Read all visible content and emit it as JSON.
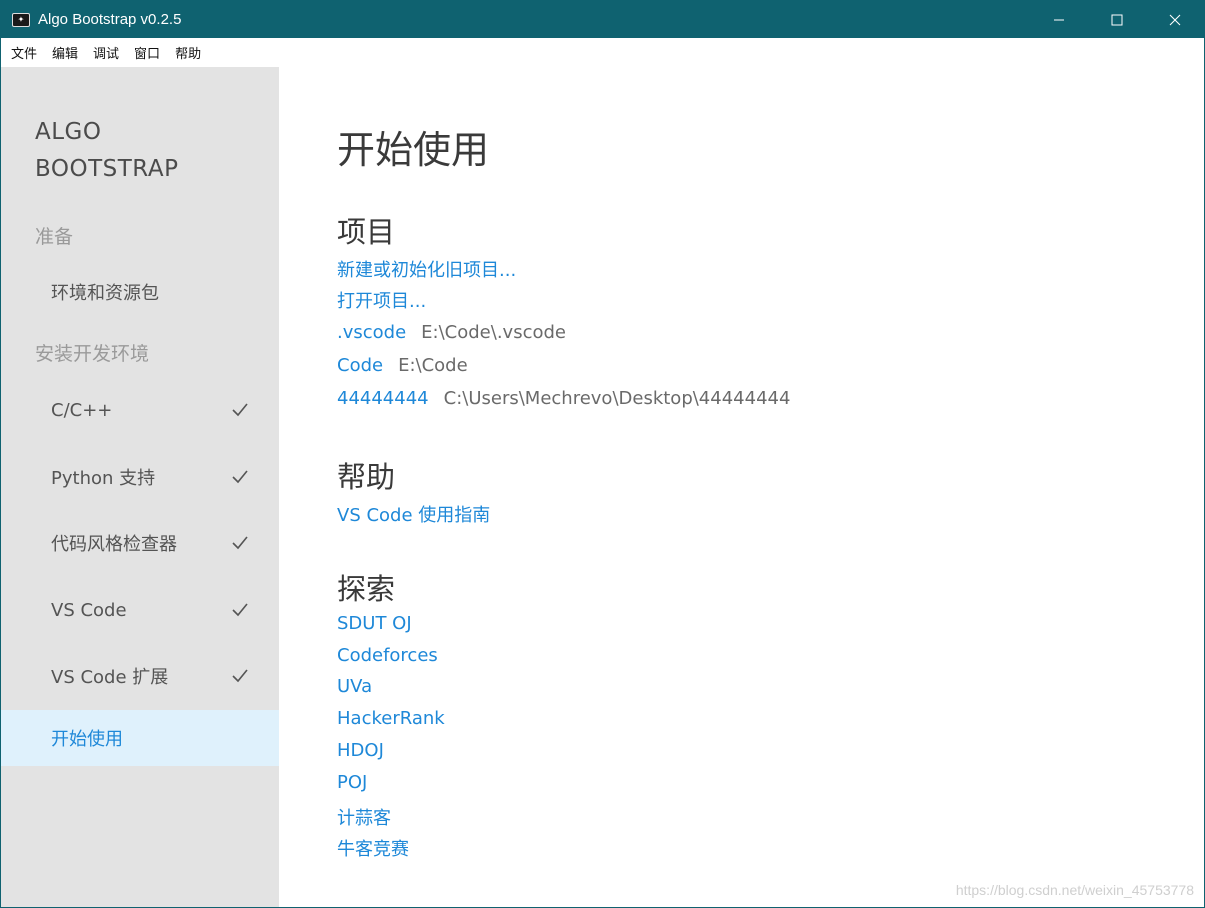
{
  "window": {
    "title": "Algo Bootstrap v0.2.5"
  },
  "menu": [
    "文件",
    "编辑",
    "调试",
    "窗口",
    "帮助"
  ],
  "sidebar": {
    "brand_line1": "ALGO",
    "brand_line2": "BOOTSTRAP",
    "sections": [
      {
        "title": "准备",
        "items": [
          {
            "label": "环境和资源包",
            "checked": false
          }
        ]
      },
      {
        "title": "安装开发环境",
        "items": [
          {
            "label": "C/C++",
            "checked": true
          },
          {
            "label": "Python 支持",
            "checked": true
          },
          {
            "label": "代码风格检查器",
            "checked": true
          },
          {
            "label": "VS Code",
            "checked": true
          },
          {
            "label": "VS Code 扩展",
            "checked": true
          },
          {
            "label": "开始使用",
            "checked": false,
            "active": true
          }
        ]
      }
    ]
  },
  "main": {
    "title": "开始使用",
    "project": {
      "heading": "项目",
      "actions": [
        "新建或初始化旧项目...",
        "打开项目..."
      ],
      "recent": [
        {
          "name": ".vscode",
          "path": "E:\\Code\\.vscode"
        },
        {
          "name": "Code",
          "path": "E:\\Code"
        },
        {
          "name": "44444444",
          "path": "C:\\Users\\Mechrevo\\Desktop\\44444444"
        }
      ]
    },
    "help": {
      "heading": "帮助",
      "links": [
        "VS Code 使用指南"
      ]
    },
    "explore": {
      "heading": "探索",
      "links": [
        "SDUT OJ",
        "Codeforces",
        "UVa",
        "HackerRank",
        "HDOJ",
        "POJ",
        "计蒜客",
        "牛客竞赛"
      ]
    }
  },
  "watermark": "https://blog.csdn.net/weixin_45753778",
  "colors": {
    "titlebar": "#0f6270",
    "accent": "#1e88d8",
    "sidebar_bg": "#e3e3e3",
    "active_bg": "#dff1fc"
  }
}
